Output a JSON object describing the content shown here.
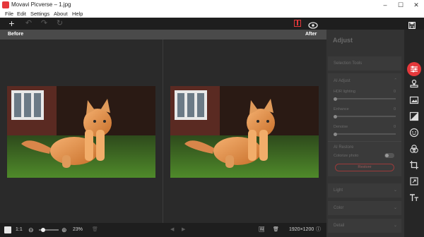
{
  "window": {
    "title": "Movavi Picverse – 1.jpg",
    "min": "–",
    "max": "☐",
    "close": "✕"
  },
  "menu": [
    "File",
    "Edit",
    "Settings",
    "About",
    "Help"
  ],
  "toolbar": {
    "add": "+",
    "undo": "↶",
    "redo": "↷",
    "reset": "↻",
    "compare": "⧉",
    "preview": "👁",
    "save": "💾"
  },
  "canvas": {
    "before_label": "Before",
    "after_label": "After"
  },
  "bottom": {
    "ratio": "1:1",
    "zoom_out": "⊖",
    "zoom_in": "⊕",
    "zoom": "23%",
    "zoom_level": 0.23,
    "delete": "🗑",
    "prev": "◀",
    "next": "▶",
    "thumb": "🖼",
    "trash": "🗑",
    "resolution": "1920×1200",
    "info": "ⓘ"
  },
  "panel": {
    "title": "Adjust",
    "selection_tools": "Selection Tools",
    "ai_adjust": {
      "title": "AI Adjust",
      "items": [
        {
          "label": "HDR lighting",
          "value": "0",
          "level": 0
        },
        {
          "label": "Enhance",
          "value": "0",
          "level": 0
        },
        {
          "label": "Denoise",
          "value": "0",
          "level": 0
        }
      ]
    },
    "ai_restore": {
      "title": "AI Restore",
      "colorize": "Colorize photo",
      "restore_button": "Restore"
    },
    "light": "Light",
    "color": "Color",
    "detail": "Detail",
    "chevron": "⌃",
    "chevron_down": "⌄"
  },
  "rail": [
    "adjust-icon",
    "stamp-icon",
    "image-icon",
    "split-icon",
    "face-icon",
    "filters-icon",
    "crop-icon",
    "expand-icon",
    "text-icon"
  ],
  "colors": {
    "accent": "#e5383b",
    "bg": "#2b2b2b"
  }
}
